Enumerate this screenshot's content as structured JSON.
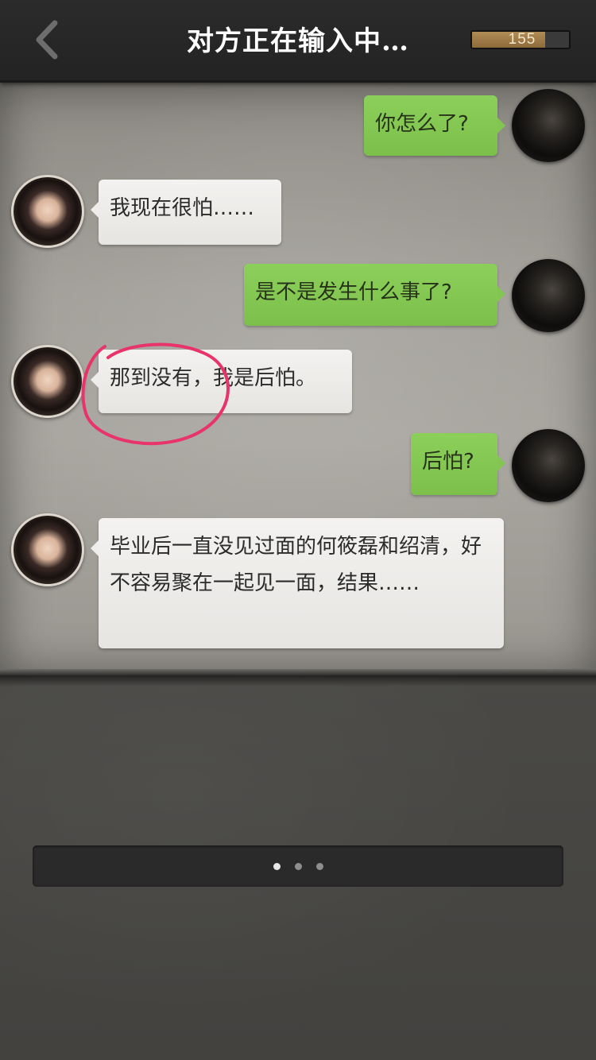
{
  "header": {
    "title": "对方正在输入中…",
    "score": "155",
    "score_fraction": 0.75
  },
  "messages": [
    {
      "side": "right",
      "text": "你怎么了?"
    },
    {
      "side": "left",
      "text": "我现在很怕……"
    },
    {
      "side": "right",
      "text": "是不是发生什么事了?"
    },
    {
      "side": "left",
      "text": "那到没有，我是后怕。"
    },
    {
      "side": "right",
      "text": "后怕?"
    },
    {
      "side": "left",
      "text": "毕业后一直没见过面的何筱磊和绍清，好不容易聚在一起见一面，结果……"
    }
  ],
  "pager": {
    "total": 3,
    "active_index": 0
  },
  "colors": {
    "sent_bubble": "#7cc04b",
    "received_bubble": "#f3f2f0",
    "annotation": "#e8336b"
  },
  "icons": {
    "back": "chevron-left-icon",
    "annotation": "hand-drawn-circle"
  }
}
